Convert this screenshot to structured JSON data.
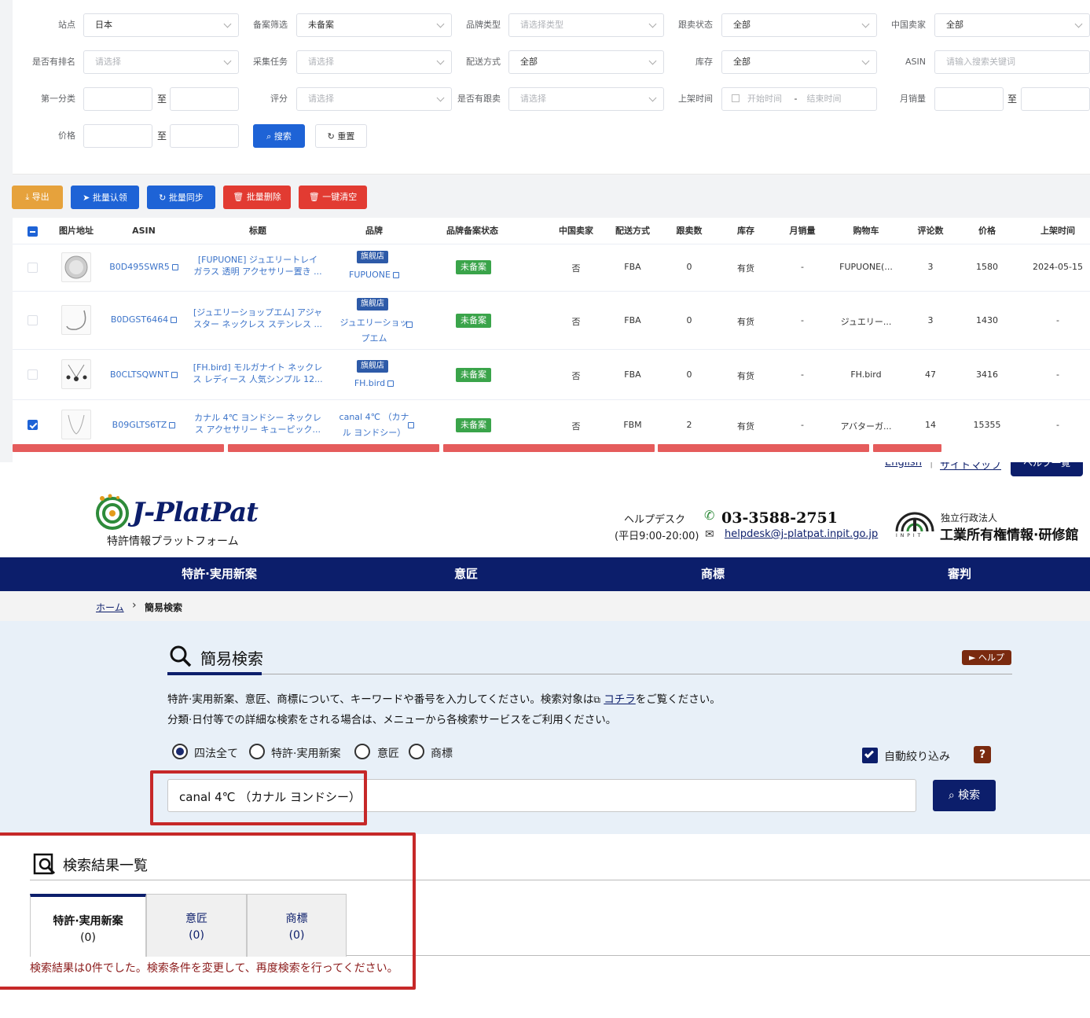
{
  "filters": {
    "row1": [
      {
        "label": "站点",
        "value": "日本",
        "placeholder": false
      },
      {
        "label": "备案筛选",
        "value": "未备案",
        "placeholder": false
      },
      {
        "label": "品牌类型",
        "value": "请选择类型",
        "placeholder": true
      },
      {
        "label": "跟卖状态",
        "value": "全部",
        "placeholder": false
      },
      {
        "label": "中国卖家",
        "value": "全部",
        "placeholder": false
      }
    ],
    "row2": [
      {
        "label": "是否有排名",
        "value": "请选择",
        "placeholder": true
      },
      {
        "label": "采集任务",
        "value": "请选择",
        "placeholder": true
      },
      {
        "label": "配送方式",
        "value": "全部",
        "placeholder": false
      },
      {
        "label": "库存",
        "value": "全部",
        "placeholder": false
      },
      {
        "label": "ASIN",
        "value": "请输入搜索关键词",
        "placeholder": true
      }
    ],
    "row3": {
      "cat_label": "第一分类",
      "to": "至",
      "rating_label": "评分",
      "rating_value": "请选择",
      "follow_label": "是否有跟卖",
      "follow_value": "请选择",
      "date_label": "上架时间",
      "date_start": "开始时间",
      "date_sep": "-",
      "date_end": "结束时间",
      "monthly_label": "月销量"
    },
    "row4": {
      "price_label": "价格",
      "search_button": "搜索",
      "reset_button": "重置"
    }
  },
  "actions": {
    "export": "导出",
    "batch_claim": "批量认领",
    "batch_sync": "批量同步",
    "batch_delete": "批量删除",
    "clear_all": "一键清空"
  },
  "table": {
    "headers": [
      "图片地址",
      "ASIN",
      "标题",
      "品牌",
      "品牌备案状态",
      "中国卖家",
      "配送方式",
      "跟卖数",
      "库存",
      "月销量",
      "购物车",
      "评论数",
      "价格",
      "上架时间"
    ],
    "rows": [
      {
        "checked": false,
        "asin": "B0D495SWR5",
        "title1": "[FUPUONE] ジュエリートレイ",
        "title2": "ガラス 透明 アクセサリー置き ...",
        "flag": "旗舰店",
        "brand1": "FUPUONE",
        "brand2": "",
        "status": "未备案",
        "cn": "否",
        "ship": "FBA",
        "follow": "0",
        "stock": "有货",
        "monthly": "-",
        "cart": "FUPUONE(...",
        "reviews": "3",
        "price": "1580",
        "date": "2024-05-15"
      },
      {
        "checked": false,
        "asin": "B0DGST6464",
        "title1": "[ジュエリーショップエム] アジャ",
        "title2": "スター ネックレス ステンレス ...",
        "flag": "旗舰店",
        "brand1": "ジュエリーショッ",
        "brand2": "プエム",
        "status": "未备案",
        "cn": "否",
        "ship": "FBA",
        "follow": "0",
        "stock": "有货",
        "monthly": "-",
        "cart": "ジュエリー...",
        "reviews": "3",
        "price": "1430",
        "date": "-"
      },
      {
        "checked": false,
        "asin": "B0CLTSQWNT",
        "title1": "[FH.bird] モルガナイト ネックレ",
        "title2": "ス レディース 人気シンプル 12...",
        "flag": "旗舰店",
        "brand1": "FH.bird",
        "brand2": "",
        "status": "未备案",
        "cn": "否",
        "ship": "FBA",
        "follow": "0",
        "stock": "有货",
        "monthly": "-",
        "cart": "FH.bird",
        "reviews": "47",
        "price": "3416",
        "date": "-"
      },
      {
        "checked": true,
        "asin": "B09GLTS6TZ",
        "title1": "カナル 4℃ ヨンドシー ネックレ",
        "title2": "ス アクセサリー キューピック...",
        "flag": "",
        "brand1": "canal 4℃ （カナ",
        "brand2": "ル ヨンドシー）",
        "status": "未备案",
        "cn": "否",
        "ship": "FBM",
        "follow": "2",
        "stock": "有货",
        "monthly": "-",
        "cart": "アバターガ...",
        "reviews": "14",
        "price": "15355",
        "date": "-"
      }
    ]
  },
  "jplatpat": {
    "logo_text": "J-PlatPat",
    "logo_sub": "特許情報プラットフォーム",
    "top_links": [
      "English",
      "サイトマップ",
      "ヘルプ一覧"
    ],
    "helpdesk_label": "ヘルプデスク",
    "helpdesk_hours": "(平日9:00-20:00)",
    "phone": "03-3588-2751",
    "email": "helpdesk@j-platpat.inpit.go.jp",
    "inpit_sub": "INPIT",
    "org_small": "独立行政法人",
    "org_name": "工業所有権情報·研修館",
    "nav": [
      "特許·実用新案",
      "意匠",
      "商標",
      "審判"
    ],
    "breadcrumb_home": "ホーム",
    "breadcrumb_sep": "›",
    "breadcrumb_current": "簡易検索",
    "search_title": "簡易検索",
    "help_button": "► ヘルプ",
    "desc1_a": "特許·実用新案、意匠、商標について、キーワードや番号を入力してください。検索対象は",
    "desc1_link": "コチラ",
    "desc1_b": "をご覧ください。",
    "desc2": "分類·日付等での詳細な検索をされる場合は、メニューから各検索サービスをご利用ください。",
    "radios": [
      "四法全て",
      "特許·実用新案",
      "意匠",
      "商標"
    ],
    "auto_filter": "自動絞り込み",
    "help_q": "?",
    "search_value": "canal 4℃ （カナル ヨンドシー）",
    "search_button": "検索",
    "results_title": "検索結果一覧",
    "tabs": [
      {
        "name": "特許·実用新案",
        "count": "(0)"
      },
      {
        "name": "意匠",
        "count": "(0)"
      },
      {
        "name": "商標",
        "count": "(0)"
      }
    ],
    "no_results": "検索結果は0件でした。検索条件を変更して、再度検索を行ってください。"
  },
  "colors": {
    "primary_blue": "#1e63d6",
    "nav_navy": "#0c1e6b",
    "annotation_red": "#c62828",
    "status_green": "#3aa44a"
  }
}
